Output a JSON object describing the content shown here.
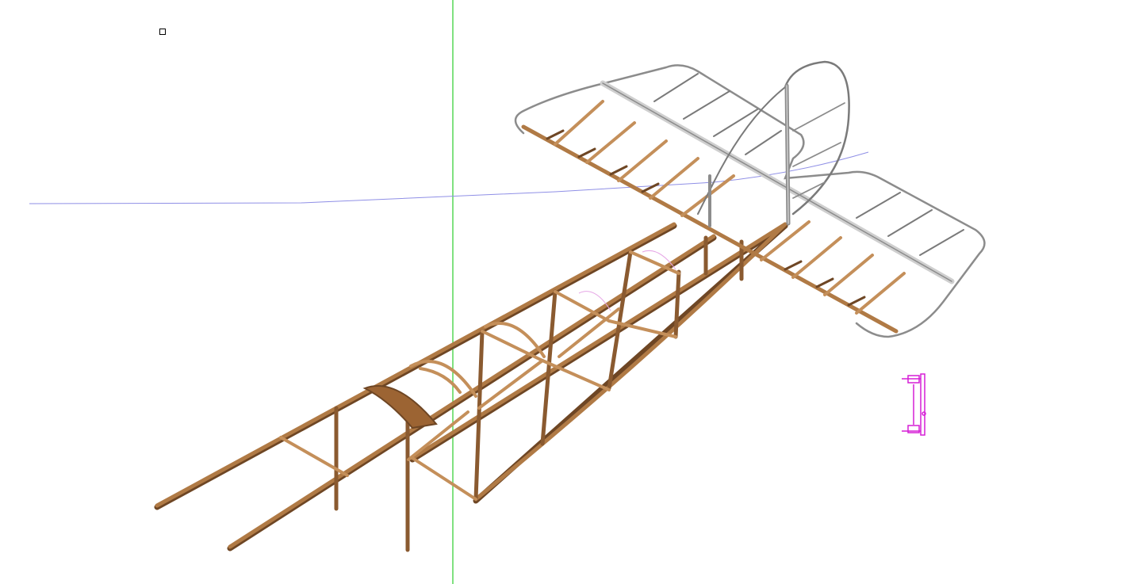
{
  "viewport": {
    "background": "#ffffff"
  },
  "axes": {
    "green_axis_color": "#3dd13d",
    "blue_axis_color": "#8f8fe6"
  },
  "model": {
    "wood_color": "#a8713e",
    "wood_light_color": "#c48f5a",
    "wood_dark_color": "#6e4624",
    "metal_color": "#8c8c8c",
    "metal_light_color": "#cfcfcf"
  },
  "selection": {
    "gizmo_color": "#d61fd6"
  },
  "icons": {
    "origin_marker": "small-square-icon",
    "gizmo": "component-gizmo-icon"
  }
}
